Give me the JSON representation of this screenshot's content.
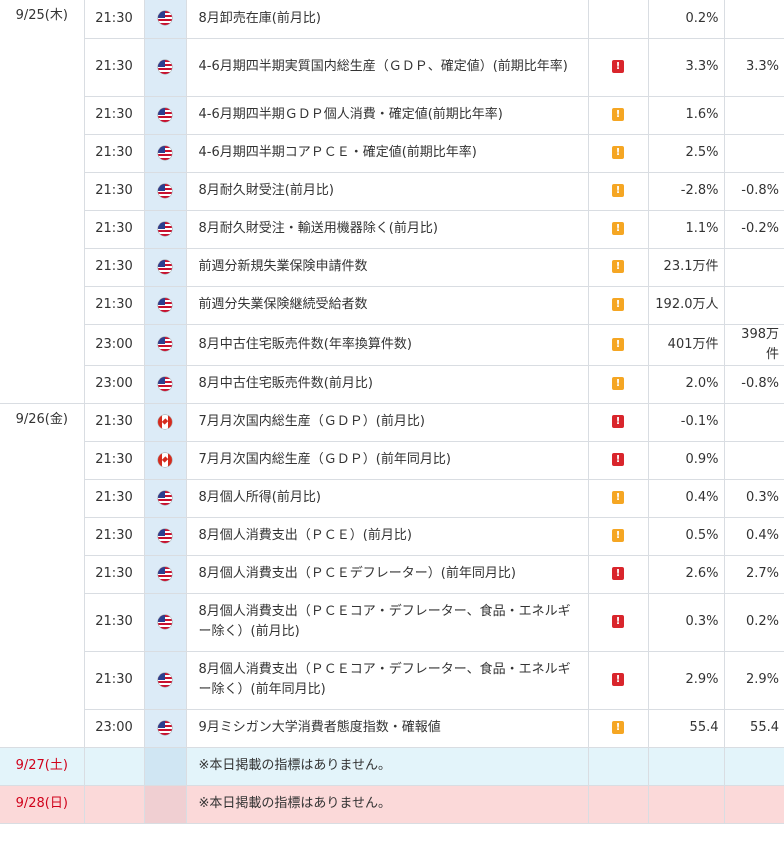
{
  "colors": {
    "flag_column_bg": "#dcebf7",
    "saturday_row_bg": "#e3f4fa",
    "sunday_row_bg": "#fbd9d9",
    "high_importance": "#d9252c",
    "medium_importance": "#f5a623",
    "weekend_date_text": "#d0021b"
  },
  "importance_symbol": "!",
  "days": [
    {
      "date": "9/25(木)",
      "events": [
        {
          "time": "21:30",
          "country": "US",
          "name": "8月卸売在庫(前月比)",
          "importance": "",
          "forecast": "0.2%",
          "result": ""
        },
        {
          "time": "21:30",
          "country": "US",
          "name": "4-6月期四半期実質国内総生産（ＧＤＰ、確定値）(前期比年率)",
          "importance": "high",
          "forecast": "3.3%",
          "result": "3.3%"
        },
        {
          "time": "21:30",
          "country": "US",
          "name": "4-6月期四半期ＧＤＰ個人消費・確定値(前期比年率)",
          "importance": "mid",
          "forecast": "1.6%",
          "result": ""
        },
        {
          "time": "21:30",
          "country": "US",
          "name": "4-6月期四半期コアＰＣＥ・確定値(前期比年率)",
          "importance": "mid",
          "forecast": "2.5%",
          "result": ""
        },
        {
          "time": "21:30",
          "country": "US",
          "name": "8月耐久財受注(前月比)",
          "importance": "mid",
          "forecast": "-2.8%",
          "result": "-0.8%"
        },
        {
          "time": "21:30",
          "country": "US",
          "name": "8月耐久財受注・輸送用機器除く(前月比)",
          "importance": "mid",
          "forecast": "1.1%",
          "result": "-0.2%"
        },
        {
          "time": "21:30",
          "country": "US",
          "name": "前週分新規失業保険申請件数",
          "importance": "mid",
          "forecast": "23.1万件",
          "result": ""
        },
        {
          "time": "21:30",
          "country": "US",
          "name": "前週分失業保険継続受給者数",
          "importance": "mid",
          "forecast": "192.0万人",
          "result": ""
        },
        {
          "time": "23:00",
          "country": "US",
          "name": "8月中古住宅販売件数(年率換算件数)",
          "importance": "mid",
          "forecast": "401万件",
          "result": "398万件"
        },
        {
          "time": "23:00",
          "country": "US",
          "name": "8月中古住宅販売件数(前月比)",
          "importance": "mid",
          "forecast": "2.0%",
          "result": "-0.8%"
        }
      ]
    },
    {
      "date": "9/26(金)",
      "events": [
        {
          "time": "21:30",
          "country": "CA",
          "name": "7月月次国内総生産（ＧＤＰ）(前月比)",
          "importance": "high",
          "forecast": "-0.1%",
          "result": ""
        },
        {
          "time": "21:30",
          "country": "CA",
          "name": "7月月次国内総生産（ＧＤＰ）(前年同月比)",
          "importance": "high",
          "forecast": "0.9%",
          "result": ""
        },
        {
          "time": "21:30",
          "country": "US",
          "name": "8月個人所得(前月比)",
          "importance": "mid",
          "forecast": "0.4%",
          "result": "0.3%"
        },
        {
          "time": "21:30",
          "country": "US",
          "name": "8月個人消費支出（ＰＣＥ）(前月比)",
          "importance": "mid",
          "forecast": "0.5%",
          "result": "0.4%"
        },
        {
          "time": "21:30",
          "country": "US",
          "name": "8月個人消費支出（ＰＣＥデフレーター）(前年同月比)",
          "importance": "high",
          "forecast": "2.6%",
          "result": "2.7%"
        },
        {
          "time": "21:30",
          "country": "US",
          "name": "8月個人消費支出（ＰＣＥコア・デフレーター、食品・エネルギー除く）(前月比)",
          "importance": "high",
          "forecast": "0.3%",
          "result": "0.2%"
        },
        {
          "time": "21:30",
          "country": "US",
          "name": "8月個人消費支出（ＰＣＥコア・デフレーター、食品・エネルギー除く）(前年同月比)",
          "importance": "high",
          "forecast": "2.9%",
          "result": "2.9%"
        },
        {
          "time": "23:00",
          "country": "US",
          "name": "9月ミシガン大学消費者態度指数・確報値",
          "importance": "mid",
          "forecast": "55.4",
          "result": "55.4"
        }
      ]
    }
  ],
  "weekend": [
    {
      "date": "9/27(土)",
      "day_type": "sat",
      "message": "※本日掲載の指標はありません。"
    },
    {
      "date": "9/28(日)",
      "day_type": "sun",
      "message": "※本日掲載の指標はありません。"
    }
  ]
}
